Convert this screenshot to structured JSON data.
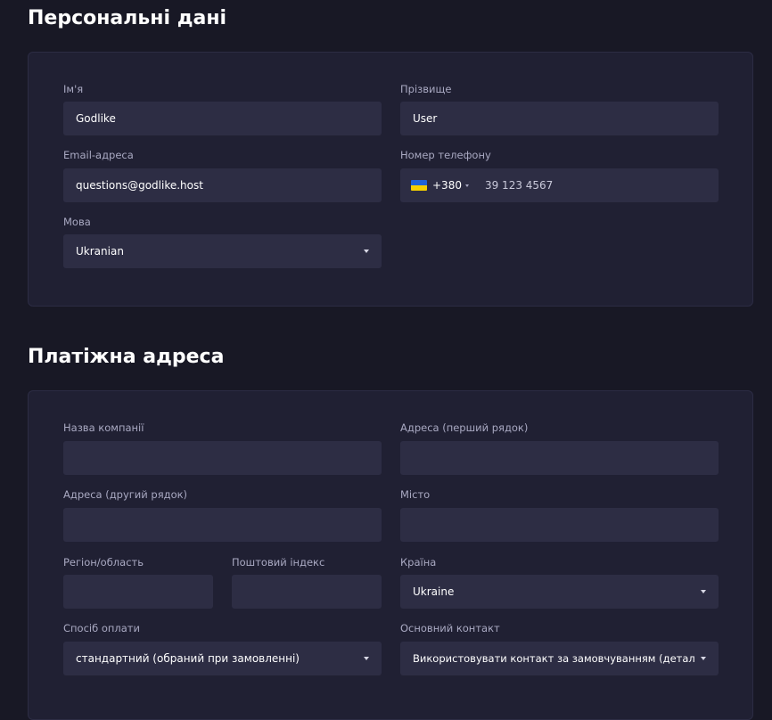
{
  "personal": {
    "title": "Персональні дані",
    "first_name": {
      "label": "Ім'я",
      "value": "Godlike"
    },
    "last_name": {
      "label": "Прізвище",
      "value": "User"
    },
    "email": {
      "label": "Email-адреса",
      "value": "questions@godlike.host"
    },
    "phone": {
      "label": "Номер телефону",
      "country_flag": "ukraine-flag-icon",
      "code": "+380",
      "number": "39 123 4567"
    },
    "language": {
      "label": "Мова",
      "value": "Ukranian"
    }
  },
  "billing": {
    "title": "Платіжна адреса",
    "company": {
      "label": "Назва компанії",
      "value": ""
    },
    "address1": {
      "label": "Адреса (перший рядок)",
      "value": ""
    },
    "address2": {
      "label": "Адреса (другий рядок)",
      "value": ""
    },
    "city": {
      "label": "Місто",
      "value": ""
    },
    "region": {
      "label": "Регіон/область",
      "value": ""
    },
    "postcode": {
      "label": "Поштовий індекс",
      "value": ""
    },
    "country": {
      "label": "Країна",
      "value": "Ukraine"
    },
    "payment_method": {
      "label": "Спосіб оплати",
      "value": "стандартний (обраний при замовленні)"
    },
    "main_contact": {
      "label": "Основний контакт",
      "value": "Використовувати контакт за замовчуванням (деталі вище)"
    }
  },
  "colors": {
    "background": "#181825",
    "card": "#202033",
    "input": "#2d2d44",
    "label": "#a9a9c2",
    "flag_blue": "#1f63d8",
    "flag_yellow": "#f5d000"
  }
}
